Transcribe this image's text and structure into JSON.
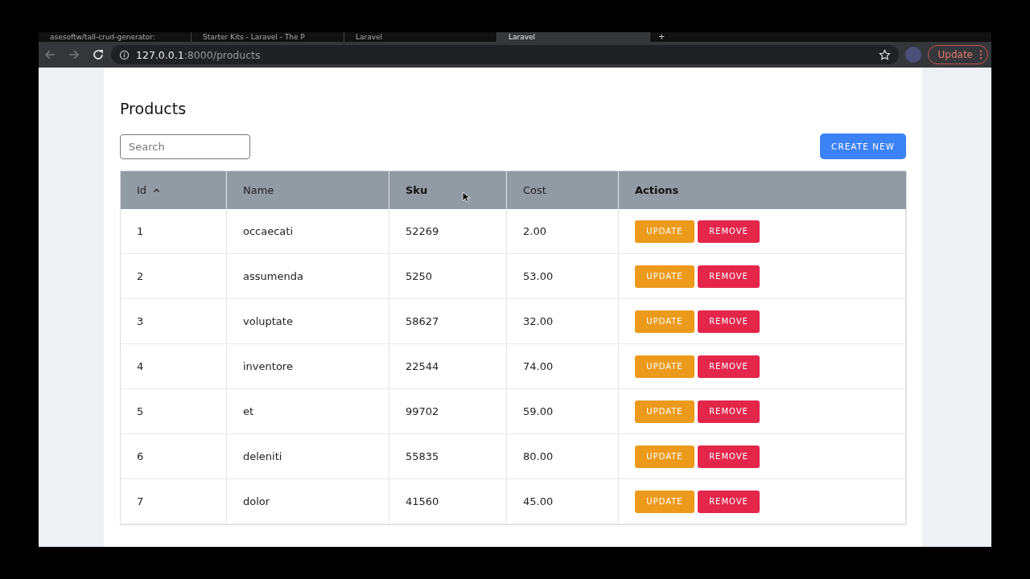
{
  "browser": {
    "tabs": [
      {
        "title": "asesoftw/tall-crud-generator:",
        "selected": false
      },
      {
        "title": "Starter Kits - Laravel - The P",
        "selected": false
      },
      {
        "title": "Laravel",
        "selected": false
      },
      {
        "title": "Laravel",
        "selected": true
      }
    ],
    "new_tab": "+",
    "url_host": "127.0.0.1",
    "url_path": ":8000/products",
    "update_button": "Update"
  },
  "page": {
    "title": "Products",
    "search": {
      "placeholder": "Search"
    },
    "create_button": "CREATE NEW",
    "table": {
      "columns": [
        {
          "label": "Id",
          "sorted": true,
          "bold": false
        },
        {
          "label": "Name",
          "sorted": false,
          "bold": false
        },
        {
          "label": "Sku",
          "sorted": false,
          "bold": true
        },
        {
          "label": "Cost",
          "sorted": false,
          "bold": false
        },
        {
          "label": "Actions",
          "sorted": false,
          "bold": true
        }
      ],
      "rows": [
        {
          "id": "1",
          "name": "occaecati",
          "sku": "52269",
          "cost": "2.00",
          "actions": [
            "UPDATE",
            "REMOVE"
          ]
        },
        {
          "id": "2",
          "name": "assumenda",
          "sku": "5250",
          "cost": "53.00",
          "actions": [
            "UPDATE",
            "REMOVE"
          ]
        },
        {
          "id": "3",
          "name": "voluptate",
          "sku": "58627",
          "cost": "32.00",
          "actions": [
            "UPDATE",
            "REMOVE"
          ]
        },
        {
          "id": "4",
          "name": "inventore",
          "sku": "22544",
          "cost": "74.00",
          "actions": [
            "UPDATE",
            "REMOVE"
          ]
        },
        {
          "id": "5",
          "name": "et",
          "sku": "99702",
          "cost": "59.00",
          "actions": [
            "UPDATE",
            "REMOVE"
          ]
        },
        {
          "id": "6",
          "name": "deleniti",
          "sku": "55835",
          "cost": "80.00",
          "actions": [
            "UPDATE",
            "REMOVE"
          ]
        },
        {
          "id": "7",
          "name": "dolor",
          "sku": "41560",
          "cost": "45.00",
          "actions": [
            "UPDATE",
            "REMOVE"
          ]
        }
      ]
    }
  }
}
